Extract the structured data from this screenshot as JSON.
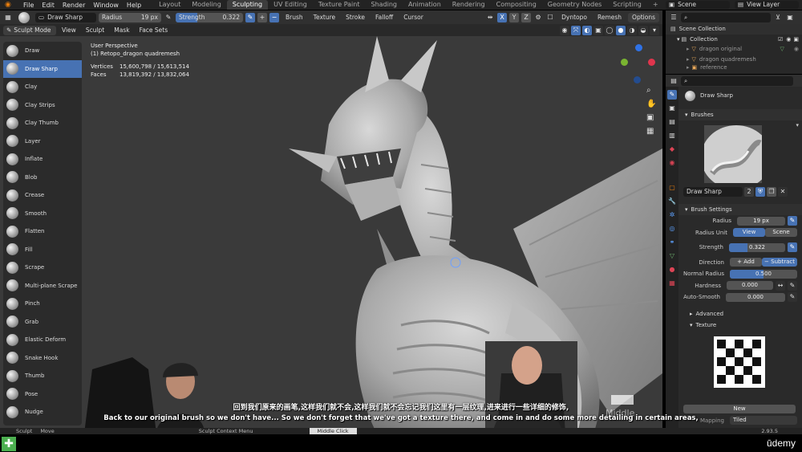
{
  "menubar": {
    "menus": [
      "File",
      "Edit",
      "Render",
      "Window",
      "Help"
    ],
    "workspaces": [
      "Layout",
      "Modeling",
      "Sculpting",
      "UV Editing",
      "Texture Paint",
      "Shading",
      "Animation",
      "Rendering",
      "Compositing",
      "Geometry Nodes",
      "Scripting"
    ],
    "active_workspace": "Sculpting",
    "add_tab": "+",
    "scene": "Scene",
    "view_layer": "View Layer"
  },
  "tool_header": {
    "brush_name": "Draw Sharp",
    "radius_label": "Radius",
    "radius_value": "19 px",
    "strength_label": "Strength",
    "strength_value": "0.322",
    "strength_fraction": 0.322,
    "plus": "+",
    "minus": "−",
    "dropdowns": [
      "Brush",
      "Texture",
      "Stroke",
      "Falloff",
      "Cursor"
    ],
    "axes": [
      "X",
      "Y",
      "Z"
    ],
    "dyntopo": "Dyntopo",
    "remesh": "Remesh",
    "options": "Options"
  },
  "viewport_header": {
    "mode": "Sculpt Mode",
    "menus": [
      "View",
      "Sculpt",
      "Mask",
      "Face Sets"
    ]
  },
  "overlay": {
    "perspective": "User Perspective",
    "object": "(1) Retopo_dragon quadremesh",
    "vertices_label": "Vertices",
    "vertices_value": "15,600,798 / 15,613,514",
    "faces_label": "Faces",
    "faces_value": "13,819,392 / 13,832,064"
  },
  "tools": [
    {
      "label": "Draw"
    },
    {
      "label": "Draw Sharp"
    },
    {
      "label": "Clay"
    },
    {
      "label": "Clay Strips"
    },
    {
      "label": "Clay Thumb"
    },
    {
      "label": "Layer"
    },
    {
      "label": "Inflate"
    },
    {
      "label": "Blob"
    },
    {
      "label": "Crease"
    },
    {
      "label": "Smooth"
    },
    {
      "label": "Flatten"
    },
    {
      "label": "Fill"
    },
    {
      "label": "Scrape"
    },
    {
      "label": "Multi-plane Scrape"
    },
    {
      "label": "Pinch"
    },
    {
      "label": "Grab"
    },
    {
      "label": "Elastic Deform"
    },
    {
      "label": "Snake Hook"
    },
    {
      "label": "Thumb"
    },
    {
      "label": "Pose"
    },
    {
      "label": "Nudge"
    }
  ],
  "active_tool": "Draw Sharp",
  "outliner": {
    "root": "Scene Collection",
    "collection": "Collection",
    "items": [
      "dragon original",
      "dragon quadremesh",
      "reference"
    ]
  },
  "properties": {
    "brush_name": "Draw Sharp",
    "brushes_section": "Brushes",
    "brush_field": "Draw Sharp",
    "brush_users": "2",
    "brush_settings_section": "Brush Settings",
    "radius_label": "Radius",
    "radius_value": "19 px",
    "radius_unit_label": "Radius Unit",
    "radius_unit_options": [
      "View",
      "Scene"
    ],
    "strength_label": "Strength",
    "strength_value": "0.322",
    "direction_label": "Direction",
    "direction_add": "Add",
    "direction_subtract": "Subtract",
    "normal_radius_label": "Normal Radius",
    "normal_radius_value": "0.500",
    "normal_radius_fraction": 0.5,
    "hardness_label": "Hardness",
    "hardness_value": "0.000",
    "autosmooth_label": "Auto-Smooth",
    "autosmooth_value": "0.000",
    "advanced_section": "Advanced",
    "texture_section": "Texture",
    "new_button": "New",
    "mapping_label": "Mapping",
    "mapping_value": "Tiled"
  },
  "statusbar": {
    "left1": "Sculpt",
    "left2": "Move",
    "center": "Sculpt Context Menu",
    "mouse_hint": "Middle Click",
    "version": "2.93.5"
  },
  "subtitles": {
    "chinese": "回到我们原来的画笔,这样我们就不会,这样我们就不会忘记我们这里有一层纹理,进来进行一些详细的修饰,",
    "english": "Back to our original brush so we don't have... So we don't forget that we've got a texture there, and come in and do some more detailing in certain areas,"
  },
  "overlay_hint": "Middle",
  "brand": "ūdemy",
  "colors": {
    "accent": "#4772b3",
    "blender_orange": "#e87d0d",
    "viewport_bg": "#3a3a3a",
    "panel_bg": "#2a2a2a"
  }
}
